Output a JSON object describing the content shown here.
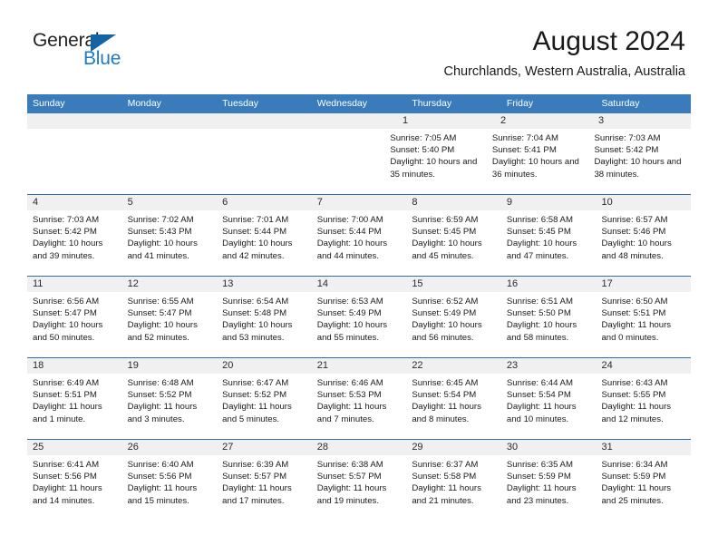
{
  "brand": {
    "name_top": "General",
    "name_bottom": "Blue",
    "triangle_icon": "triangle-icon",
    "color_dark": "#231f20",
    "color_blue": "#1f7ac4",
    "color_triangle": "#1364a5"
  },
  "header": {
    "title": "August 2024",
    "location": "Churchlands, Western Australia, Australia"
  },
  "colors": {
    "header_blue": "#3a7cbb",
    "week_divider": "#2f6da8",
    "daynum_band": "#f0f0f0"
  },
  "weekdays": [
    "Sunday",
    "Monday",
    "Tuesday",
    "Wednesday",
    "Thursday",
    "Friday",
    "Saturday"
  ],
  "weeks": [
    [
      {
        "blank": true
      },
      {
        "blank": true
      },
      {
        "blank": true
      },
      {
        "blank": true
      },
      {
        "day": "1",
        "sunrise": "Sunrise: 7:05 AM",
        "sunset": "Sunset: 5:40 PM",
        "daylight": "Daylight: 10 hours and 35 minutes."
      },
      {
        "day": "2",
        "sunrise": "Sunrise: 7:04 AM",
        "sunset": "Sunset: 5:41 PM",
        "daylight": "Daylight: 10 hours and 36 minutes."
      },
      {
        "day": "3",
        "sunrise": "Sunrise: 7:03 AM",
        "sunset": "Sunset: 5:42 PM",
        "daylight": "Daylight: 10 hours and 38 minutes."
      }
    ],
    [
      {
        "day": "4",
        "sunrise": "Sunrise: 7:03 AM",
        "sunset": "Sunset: 5:42 PM",
        "daylight": "Daylight: 10 hours and 39 minutes."
      },
      {
        "day": "5",
        "sunrise": "Sunrise: 7:02 AM",
        "sunset": "Sunset: 5:43 PM",
        "daylight": "Daylight: 10 hours and 41 minutes."
      },
      {
        "day": "6",
        "sunrise": "Sunrise: 7:01 AM",
        "sunset": "Sunset: 5:44 PM",
        "daylight": "Daylight: 10 hours and 42 minutes."
      },
      {
        "day": "7",
        "sunrise": "Sunrise: 7:00 AM",
        "sunset": "Sunset: 5:44 PM",
        "daylight": "Daylight: 10 hours and 44 minutes."
      },
      {
        "day": "8",
        "sunrise": "Sunrise: 6:59 AM",
        "sunset": "Sunset: 5:45 PM",
        "daylight": "Daylight: 10 hours and 45 minutes."
      },
      {
        "day": "9",
        "sunrise": "Sunrise: 6:58 AM",
        "sunset": "Sunset: 5:45 PM",
        "daylight": "Daylight: 10 hours and 47 minutes."
      },
      {
        "day": "10",
        "sunrise": "Sunrise: 6:57 AM",
        "sunset": "Sunset: 5:46 PM",
        "daylight": "Daylight: 10 hours and 48 minutes."
      }
    ],
    [
      {
        "day": "11",
        "sunrise": "Sunrise: 6:56 AM",
        "sunset": "Sunset: 5:47 PM",
        "daylight": "Daylight: 10 hours and 50 minutes."
      },
      {
        "day": "12",
        "sunrise": "Sunrise: 6:55 AM",
        "sunset": "Sunset: 5:47 PM",
        "daylight": "Daylight: 10 hours and 52 minutes."
      },
      {
        "day": "13",
        "sunrise": "Sunrise: 6:54 AM",
        "sunset": "Sunset: 5:48 PM",
        "daylight": "Daylight: 10 hours and 53 minutes."
      },
      {
        "day": "14",
        "sunrise": "Sunrise: 6:53 AM",
        "sunset": "Sunset: 5:49 PM",
        "daylight": "Daylight: 10 hours and 55 minutes."
      },
      {
        "day": "15",
        "sunrise": "Sunrise: 6:52 AM",
        "sunset": "Sunset: 5:49 PM",
        "daylight": "Daylight: 10 hours and 56 minutes."
      },
      {
        "day": "16",
        "sunrise": "Sunrise: 6:51 AM",
        "sunset": "Sunset: 5:50 PM",
        "daylight": "Daylight: 10 hours and 58 minutes."
      },
      {
        "day": "17",
        "sunrise": "Sunrise: 6:50 AM",
        "sunset": "Sunset: 5:51 PM",
        "daylight": "Daylight: 11 hours and 0 minutes."
      }
    ],
    [
      {
        "day": "18",
        "sunrise": "Sunrise: 6:49 AM",
        "sunset": "Sunset: 5:51 PM",
        "daylight": "Daylight: 11 hours and 1 minute."
      },
      {
        "day": "19",
        "sunrise": "Sunrise: 6:48 AM",
        "sunset": "Sunset: 5:52 PM",
        "daylight": "Daylight: 11 hours and 3 minutes."
      },
      {
        "day": "20",
        "sunrise": "Sunrise: 6:47 AM",
        "sunset": "Sunset: 5:52 PM",
        "daylight": "Daylight: 11 hours and 5 minutes."
      },
      {
        "day": "21",
        "sunrise": "Sunrise: 6:46 AM",
        "sunset": "Sunset: 5:53 PM",
        "daylight": "Daylight: 11 hours and 7 minutes."
      },
      {
        "day": "22",
        "sunrise": "Sunrise: 6:45 AM",
        "sunset": "Sunset: 5:54 PM",
        "daylight": "Daylight: 11 hours and 8 minutes."
      },
      {
        "day": "23",
        "sunrise": "Sunrise: 6:44 AM",
        "sunset": "Sunset: 5:54 PM",
        "daylight": "Daylight: 11 hours and 10 minutes."
      },
      {
        "day": "24",
        "sunrise": "Sunrise: 6:43 AM",
        "sunset": "Sunset: 5:55 PM",
        "daylight": "Daylight: 11 hours and 12 minutes."
      }
    ],
    [
      {
        "day": "25",
        "sunrise": "Sunrise: 6:41 AM",
        "sunset": "Sunset: 5:56 PM",
        "daylight": "Daylight: 11 hours and 14 minutes."
      },
      {
        "day": "26",
        "sunrise": "Sunrise: 6:40 AM",
        "sunset": "Sunset: 5:56 PM",
        "daylight": "Daylight: 11 hours and 15 minutes."
      },
      {
        "day": "27",
        "sunrise": "Sunrise: 6:39 AM",
        "sunset": "Sunset: 5:57 PM",
        "daylight": "Daylight: 11 hours and 17 minutes."
      },
      {
        "day": "28",
        "sunrise": "Sunrise: 6:38 AM",
        "sunset": "Sunset: 5:57 PM",
        "daylight": "Daylight: 11 hours and 19 minutes."
      },
      {
        "day": "29",
        "sunrise": "Sunrise: 6:37 AM",
        "sunset": "Sunset: 5:58 PM",
        "daylight": "Daylight: 11 hours and 21 minutes."
      },
      {
        "day": "30",
        "sunrise": "Sunrise: 6:35 AM",
        "sunset": "Sunset: 5:59 PM",
        "daylight": "Daylight: 11 hours and 23 minutes."
      },
      {
        "day": "31",
        "sunrise": "Sunrise: 6:34 AM",
        "sunset": "Sunset: 5:59 PM",
        "daylight": "Daylight: 11 hours and 25 minutes."
      }
    ]
  ]
}
